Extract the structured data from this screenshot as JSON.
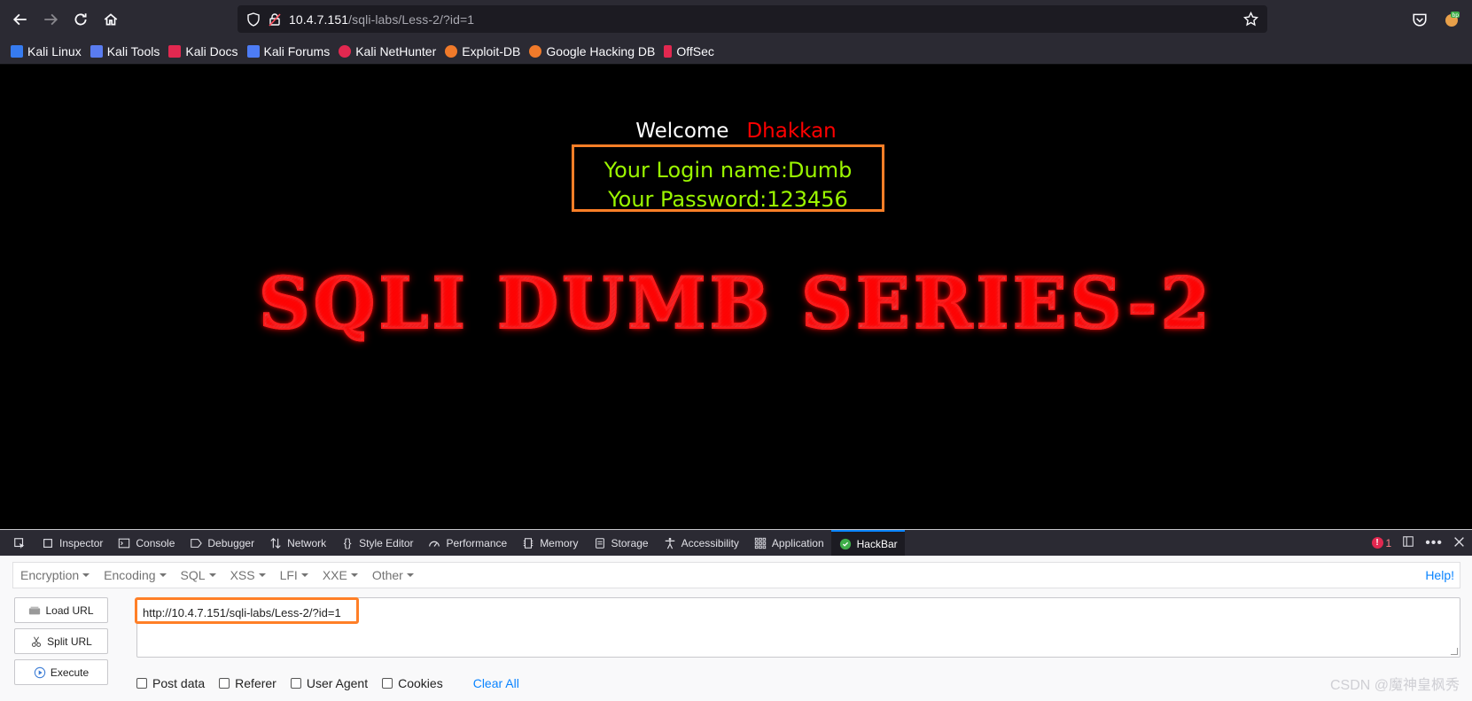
{
  "browser": {
    "url_host": "10.4.7.151",
    "url_path": "/sqli-labs/Less-2/?id=1",
    "bookmarks": [
      {
        "label": "Kali Linux",
        "color": "#367bf0"
      },
      {
        "label": "Kali Tools",
        "color": "#5a7cf0"
      },
      {
        "label": "Kali Docs",
        "color": "#e22850"
      },
      {
        "label": "Kali Forums",
        "color": "#4d7cf5"
      },
      {
        "label": "Kali NetHunter",
        "color": "#e22850"
      },
      {
        "label": "Exploit-DB",
        "color": "#f07a2a"
      },
      {
        "label": "Google Hacking DB",
        "color": "#f07a2a"
      },
      {
        "label": "OffSec",
        "color": "#e22850"
      }
    ]
  },
  "page": {
    "welcome": "Welcome",
    "user": "Dhakkan",
    "login_name": "Your Login name:Dumb",
    "password": "Your Password:123456",
    "banner": "SQLI DUMB SERIES-2"
  },
  "devtools": {
    "tabs": [
      "Inspector",
      "Console",
      "Debugger",
      "Network",
      "Style Editor",
      "Performance",
      "Memory",
      "Storage",
      "Accessibility",
      "Application",
      "HackBar"
    ],
    "active_tab": "HackBar",
    "error_count": "1"
  },
  "hackbar": {
    "menus": [
      "Encryption",
      "Encoding",
      "SQL",
      "XSS",
      "LFI",
      "XXE",
      "Other"
    ],
    "help": "Help!",
    "load_url": "Load URL",
    "split_url": "Split URL",
    "execute": "Execute",
    "url_value": "http://10.4.7.151/sqli-labs/Less-2/?id=1",
    "checkboxes": [
      "Post data",
      "Referer",
      "User Agent",
      "Cookies"
    ],
    "clear_all": "Clear All"
  },
  "watermark": "CSDN @魔神皇枫秀"
}
